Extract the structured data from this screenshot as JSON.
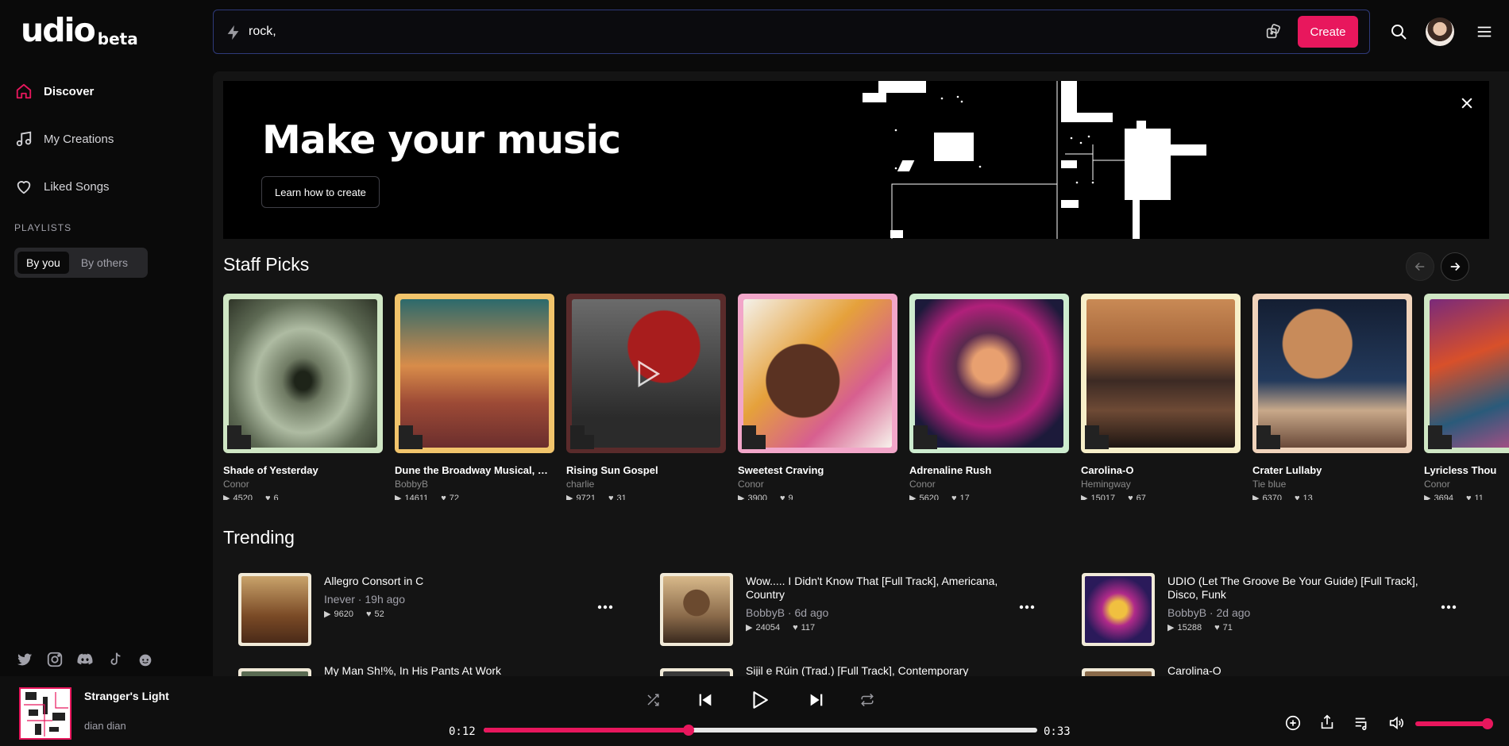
{
  "brand": {
    "wordmark": "udio",
    "tag": "beta"
  },
  "sidebar": {
    "nav": [
      {
        "label": "Discover",
        "icon": "home-icon",
        "active": true
      },
      {
        "label": "My Creations",
        "icon": "music-note-icon",
        "active": false
      },
      {
        "label": "Liked Songs",
        "icon": "heart-icon",
        "active": false
      }
    ],
    "playlists_heading": "PLAYLISTS",
    "playlist_filters": [
      "By you",
      "By others"
    ],
    "playlist_filter_selected": "By you",
    "socials": [
      "twitter-icon",
      "instagram-icon",
      "discord-icon",
      "tiktok-icon",
      "reddit-icon"
    ]
  },
  "topbar": {
    "prompt_value": "rock,",
    "create_label": "Create"
  },
  "banner": {
    "title": "Make your music",
    "cta": "Learn how to create"
  },
  "staff_picks": {
    "title": "Staff Picks",
    "items": [
      {
        "title": "Shade of Yesterday",
        "artist": "Conor",
        "plays": "4520",
        "likes": "6",
        "frame": "#cfe6c4"
      },
      {
        "title": "Dune the Broadway Musical, Sh...",
        "artist": "BobbyB",
        "plays": "14611",
        "likes": "72",
        "frame": "#f1c46b"
      },
      {
        "title": "Rising Sun Gospel",
        "artist": "charlie",
        "plays": "9721",
        "likes": "31",
        "frame": "#5a2b2b"
      },
      {
        "title": "Sweetest Craving",
        "artist": "Conor",
        "plays": "3900",
        "likes": "9",
        "frame": "#f2a6c9"
      },
      {
        "title": "Adrenaline Rush",
        "artist": "Conor",
        "plays": "5620",
        "likes": "17",
        "frame": "#cdeccf"
      },
      {
        "title": "Carolina-O",
        "artist": "Hemingway",
        "plays": "15017",
        "likes": "67",
        "frame": "#f7efc9"
      },
      {
        "title": "Crater Lullaby",
        "artist": "Tie blue",
        "plays": "6370",
        "likes": "13",
        "frame": "#f0d3bb"
      },
      {
        "title": "Lyricless Thou",
        "artist": "Conor",
        "plays": "3694",
        "likes": "11",
        "frame": "#cfe6c4"
      }
    ]
  },
  "trending": {
    "title": "Trending",
    "items": [
      {
        "title": "Allegro Consort in C",
        "artist": "Inever",
        "age": "19h ago",
        "plays": "9620",
        "likes": "52"
      },
      {
        "title": "Wow..... I Didn't Know That [Full Track], Americana, Country",
        "artist": "BobbyB",
        "age": "6d ago",
        "plays": "24054",
        "likes": "117"
      },
      {
        "title": "UDIO (Let The Groove Be Your Guide) [Full Track], Disco, Funk",
        "artist": "BobbyB",
        "age": "2d ago",
        "plays": "15288",
        "likes": "71"
      },
      {
        "title": "My Man Sh!%, In His Pants At Work"
      },
      {
        "title": "Sijil e Rúin (Trad.) [Full Track], Contemporary"
      },
      {
        "title": "Carolina-O"
      }
    ]
  },
  "player": {
    "title": "Stranger's Light",
    "artist": "dian dian",
    "current_time": "0:12",
    "total_time": "0:33",
    "progress": 0.37,
    "volume": 1.0
  },
  "colors": {
    "accent": "#e8175d",
    "background": "#0a0a0a",
    "panel": "#141414"
  }
}
